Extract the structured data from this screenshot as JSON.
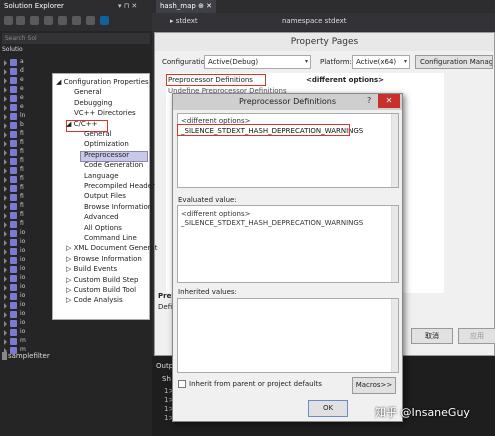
{
  "solution_explorer": {
    "title": "Solution Explorer",
    "pin": "▾ ⊓ ✕",
    "search_placeholder": "Search Sol",
    "solution_label": "Solutio",
    "items": [
      "a",
      "d",
      "e",
      "e",
      "e",
      "e",
      "ln",
      "b",
      "fi",
      "fi",
      "fi",
      "fi",
      "fi",
      "fi",
      "fi",
      "fi",
      "fi",
      "fi",
      "fi",
      "io",
      "io",
      "io",
      "io",
      "io",
      "io",
      "io",
      "io",
      "io",
      "io",
      "io",
      "io",
      "m",
      "m"
    ],
    "last_item": "samplefilter"
  },
  "editor": {
    "tab": "hash_map ⊕ ✕",
    "nav_left": "▸ stdext",
    "nav_right": "namespace stdext"
  },
  "property_pages": {
    "title": "Property Pages",
    "configuration_label": "Configuration:",
    "configuration_value": "Active(Debug)",
    "platform_label": "Platform:",
    "platform_value": "Active(x64)",
    "config_manager": "Configuration Manager...",
    "tree": [
      "◢ Configuration Properties",
      "General",
      "Debugging",
      "VC++ Directories",
      "◢ C/C++",
      "General",
      "Optimization",
      "Preprocessor",
      "Code Generation",
      "Language",
      "Precompiled Header",
      "Output Files",
      "Browse Information",
      "Advanced",
      "All Options",
      "Command Line",
      "▷ XML Document Generat",
      "▷ Browse Information",
      "▷ Build Events",
      "▷ Custom Build Step",
      "▷ Custom Build Tool",
      "▷ Code Analysis"
    ],
    "property_name": "Preprocessor Definitions",
    "property_value": "<different options>",
    "property_next": "Undefine Preprocessor Definitions",
    "desc_title": "Prep",
    "desc_text": "Defi",
    "cancel": "取消",
    "apply": "应用"
  },
  "output": {
    "title": "Outp",
    "show": "Sh",
    "lines": [
      "1>",
      "1>",
      "1>",
      "1>"
    ]
  },
  "dialog": {
    "title": "Preprocessor Definitions",
    "help": "?",
    "close": "✕",
    "edit_line1": "<different options>",
    "edit_line2": "_SILENCE_STDEXT_HASH_DEPRECATION_WARNINGS",
    "evaluated_label": "Evaluated value:",
    "eval_line1": "<different options>",
    "eval_line2": "_SILENCE_STDEXT_HASH_DEPRECATION_WARNINGS",
    "inherited_label": "Inherited values:",
    "inherit_checkbox": "Inherit from parent or project defaults",
    "macros": "Macros>>",
    "ok": "OK"
  },
  "watermark": "知乎 @InsaneGuy",
  "colors": {
    "highlight_box": "#d32222",
    "close_button": "#c9302c",
    "selected_node": "#c8c8e8"
  }
}
